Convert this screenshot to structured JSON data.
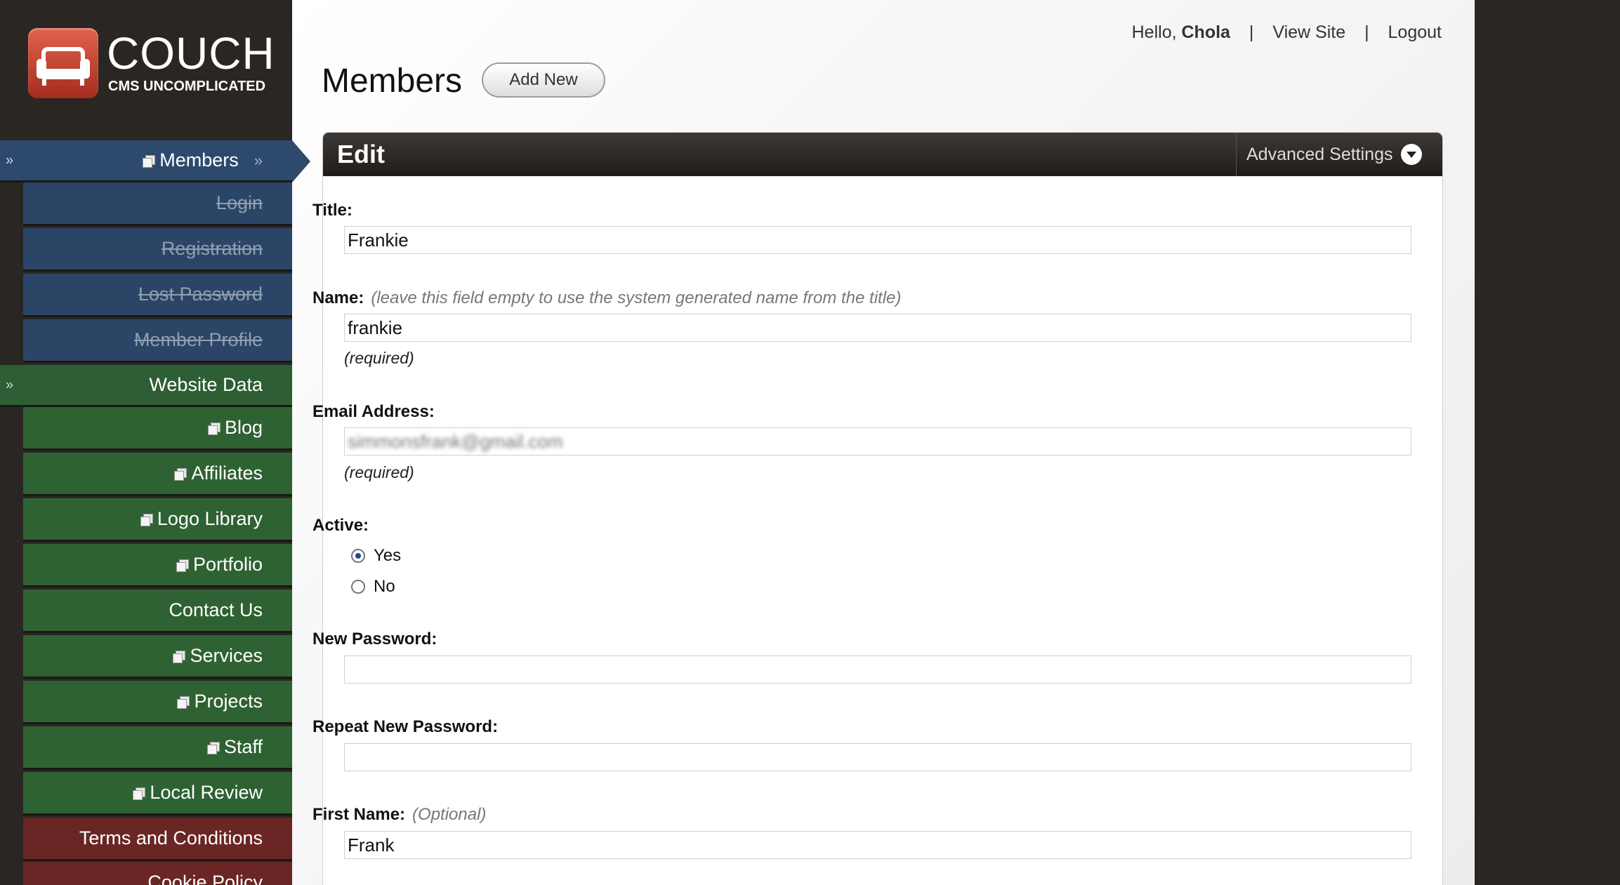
{
  "logo": {
    "word": "COUCH",
    "tagline": "CMS UNCOMPLICATED"
  },
  "sidebar": {
    "members": {
      "label": "Members",
      "items": [
        "Login",
        "Registration",
        "Lost Password",
        "Member Profile"
      ]
    },
    "website_data": {
      "label": "Website Data",
      "items": [
        "Blog",
        "Affiliates",
        "Logo Library",
        "Portfolio",
        "Contact Us",
        "Services",
        "Projects",
        "Staff",
        "Local Review"
      ]
    },
    "extra": [
      "Terms and Conditions",
      "Cookie Policy"
    ]
  },
  "topnav": {
    "hello": "Hello,",
    "user": "Chola",
    "view_site": "View Site",
    "logout": "Logout",
    "separator": "|"
  },
  "page": {
    "title": "Members",
    "add_new": "Add New"
  },
  "panel": {
    "title": "Edit",
    "advanced": "Advanced Settings"
  },
  "form": {
    "title_label": "Title:",
    "title_value": "Frankie",
    "name_label": "Name:",
    "name_hint": "(leave this field empty to use the system generated name from the title)",
    "name_value": "frankie",
    "required": "(required)",
    "email_label": "Email Address:",
    "email_value": "simmonsfrank@gmail.com",
    "active_label": "Active:",
    "active_yes": "Yes",
    "active_no": "No",
    "active_selected": "Yes",
    "new_password_label": "New Password:",
    "repeat_password_label": "Repeat New Password:",
    "first_name_label": "First Name:",
    "first_name_hint": "(Optional)",
    "first_name_value": "Frank"
  }
}
